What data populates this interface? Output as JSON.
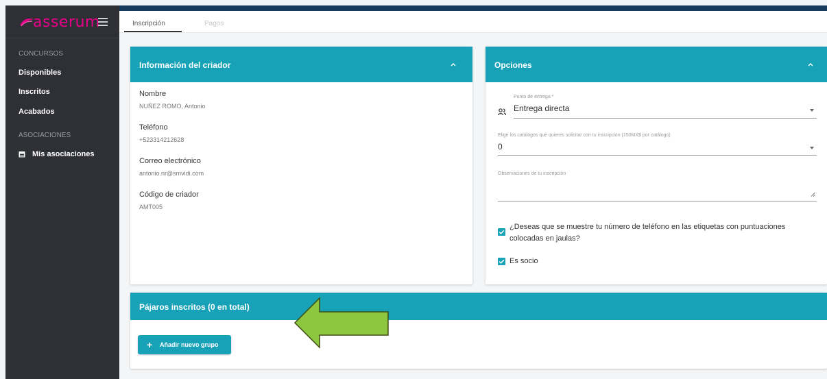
{
  "app": {
    "brand": "asserum",
    "colors": {
      "accent": "#17a2b8",
      "sidebar": "#2f3036",
      "brand": "#e6008a",
      "arrow": "#8dc63f"
    }
  },
  "tabs": [
    {
      "label": "Inscripción",
      "active": true
    },
    {
      "label": "Pagos",
      "active": false
    }
  ],
  "sidebar": {
    "sections": [
      {
        "title": "CONCURSOS",
        "items": [
          "Disponibles",
          "Inscritos",
          "Acabados"
        ]
      },
      {
        "title": "ASOCIACIONES",
        "items": [
          "Mis asociaciones"
        ]
      }
    ],
    "icons": {
      "menu": "hamburger-icon",
      "associations": "calendar-icon"
    }
  },
  "breeder_card": {
    "title": "Información del criador",
    "fields": [
      {
        "label": "Nombre",
        "value": "NUÑEZ ROMO, Antonio"
      },
      {
        "label": "Teléfono",
        "value": "+523314212628"
      },
      {
        "label": "Correo electrónico",
        "value": "antonio.nr@smvidi.com"
      },
      {
        "label": "Código de criador",
        "value": "AMT005"
      }
    ]
  },
  "options_card": {
    "title": "Opciones",
    "delivery": {
      "label": "Punto de entrega *",
      "value": "Entrega directa",
      "icon": "people-icon"
    },
    "catalogs": {
      "label": "Elige los catálogos que quieres solicitar con tu inscripción (150MX$ por catálogo)",
      "value": "0"
    },
    "observations": {
      "placeholder": "Observaciones de tu inscripción"
    },
    "checkboxes": [
      {
        "line1": "¿Deseas que se muestre tu número de teléfono en las etiquetas con puntuaciones",
        "line2": "colocadas en jaulas?",
        "checked": true
      },
      {
        "line1": "Es socio",
        "checked": true
      }
    ]
  },
  "birds_card": {
    "title": "Pájaros inscritos (0 en total)",
    "add_button": "Añadir nuevo grupo"
  }
}
